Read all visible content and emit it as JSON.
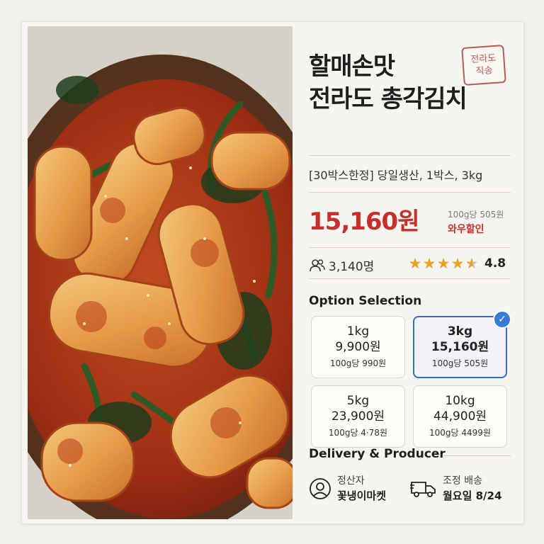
{
  "product": {
    "title_line1": "할매손맛",
    "title_line2": "전라도 총각김치",
    "stamp_line1": "전라도",
    "stamp_line2": "직송",
    "subtitle": "[30박스한정] 당일생산, 1박스, 3kg",
    "price": "15,160원",
    "unit_price": "100g당 505원",
    "discount_label": "와우할인",
    "buyers": "3,140명",
    "rating": "4.8",
    "rating_value": 4.8,
    "rating_max": 5
  },
  "options": {
    "section_title": "Option Selection",
    "selected_index": 1,
    "items": [
      {
        "weight": "1kg",
        "price": "9,900원",
        "unit": "100g당 990원"
      },
      {
        "weight": "3kg",
        "price": "15,160원",
        "unit": "100g당 505원"
      },
      {
        "weight": "5kg",
        "price": "23,900원",
        "unit": "100g당 4·78원"
      },
      {
        "weight": "10kg",
        "price": "44,900원",
        "unit": "100g당 4499원"
      }
    ]
  },
  "delivery": {
    "section_title": "Delivery & Producer",
    "producer_label": "정산자",
    "producer_name": "꽃냉이마켓",
    "shipping_label": "조정 배송",
    "shipping_date": "월요일 8/24"
  },
  "icons": {
    "buyers": "users-icon",
    "star": "star-icon",
    "check": "check-icon",
    "producer": "user-circle-icon",
    "shipping": "truck-icon"
  },
  "colors": {
    "price_red": "#c6302c",
    "star_gold": "#f0a020",
    "selected_blue": "#2f6fc4"
  }
}
